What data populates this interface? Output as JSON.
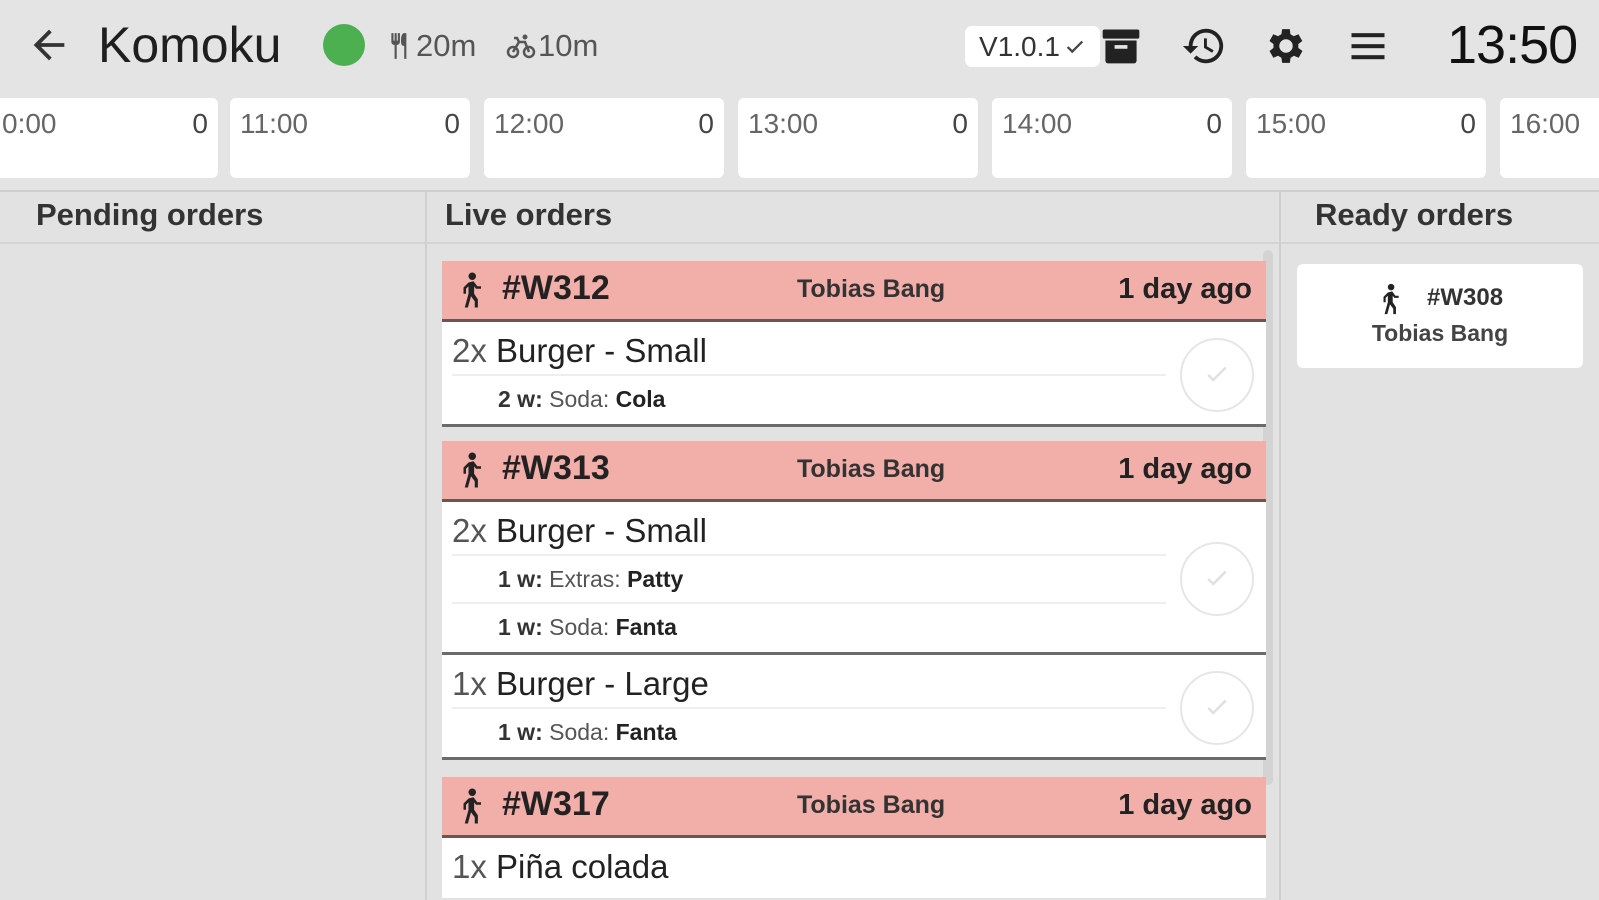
{
  "header": {
    "title": "Komoku",
    "status_color": "#4caf50",
    "prep_time": "20m",
    "delivery_time": "10m",
    "version": "V1.0.1",
    "clock": "13:50"
  },
  "timeline": [
    {
      "time": "0:00",
      "count": "0"
    },
    {
      "time": "11:00",
      "count": "0"
    },
    {
      "time": "12:00",
      "count": "0"
    },
    {
      "time": "13:00",
      "count": "0"
    },
    {
      "time": "14:00",
      "count": "0"
    },
    {
      "time": "15:00",
      "count": "0"
    },
    {
      "time": "16:00",
      "count": ""
    }
  ],
  "columns": {
    "pending": "Pending orders",
    "live": "Live orders",
    "ready": "Ready orders"
  },
  "live_orders": [
    {
      "number": "#W312",
      "customer": "Tobias Bang",
      "time": "1 day ago",
      "items": [
        {
          "qty": "2x",
          "name": "Burger - Small",
          "mods": [
            {
              "qty": "2 w:",
              "label": "Soda:",
              "value": "Cola"
            }
          ]
        }
      ]
    },
    {
      "number": "#W313",
      "customer": "Tobias Bang",
      "time": "1 day ago",
      "items": [
        {
          "qty": "2x",
          "name": "Burger - Small",
          "mods": [
            {
              "qty": "1 w:",
              "label": "Extras:",
              "value": "Patty"
            },
            {
              "qty": "1 w:",
              "label": "Soda:",
              "value": "Fanta"
            }
          ]
        },
        {
          "qty": "1x",
          "name": "Burger - Large",
          "mods": [
            {
              "qty": "1 w:",
              "label": "Soda:",
              "value": "Fanta"
            }
          ]
        }
      ]
    },
    {
      "number": "#W317",
      "customer": "Tobias Bang",
      "time": "1 day ago",
      "items": [
        {
          "qty": "1x",
          "name": "Piña colada",
          "mods": []
        }
      ]
    }
  ],
  "ready_orders": [
    {
      "number": "#W308",
      "customer": "Tobias Bang"
    }
  ],
  "icons": {
    "back": "arrow-left-icon",
    "prep": "utensils-icon",
    "delivery": "bike-icon",
    "archive": "archive-icon",
    "history": "history-icon",
    "settings": "gear-icon",
    "menu": "hamburger-menu-icon",
    "walk": "walking-person-icon",
    "check": "check-icon"
  }
}
